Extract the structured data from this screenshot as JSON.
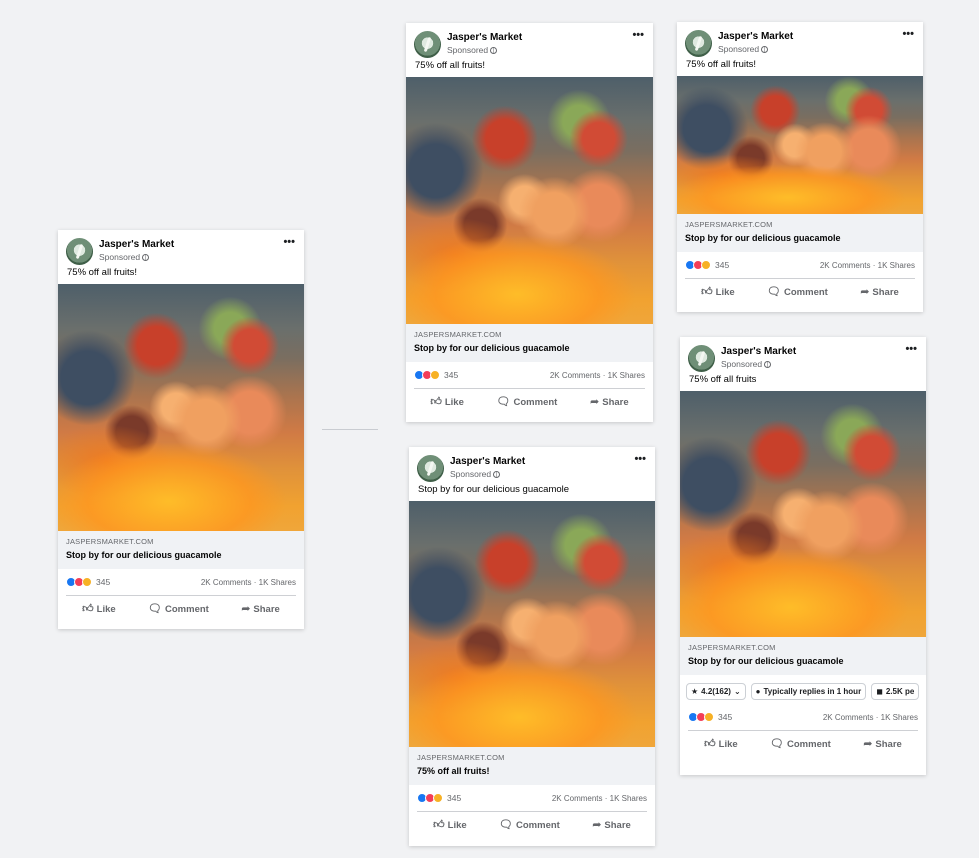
{
  "colors": {
    "background": "#f1f2f4",
    "accent": "#1877f2",
    "link_box": "#f0f2f5",
    "muted_text": "#65676b"
  },
  "icons": {
    "more": "more-dots-icon",
    "globe": "globe-icon",
    "like": "thumbs-up-icon",
    "comment": "comment-icon",
    "share": "share-icon",
    "star": "star-icon",
    "messenger": "messenger-icon"
  },
  "ads": [
    {
      "page_name": "Jasper's Market",
      "sponsored": "Sponsored",
      "primary_text": "75% off all fruits!",
      "link_url": "JASPERSMARKET.COM",
      "link_title": "Stop by for our delicious guacamole",
      "reaction_count": "345",
      "comments_shares": "2K Comments · 1K Shares",
      "like": "Like",
      "comment": "Comment",
      "share": "Share"
    },
    {
      "page_name": "Jasper's Market",
      "sponsored": "Sponsored",
      "primary_text": "75% off all fruits!",
      "link_url": "JASPERSMARKET.COM",
      "link_title": "Stop by for our delicious guacamole",
      "reaction_count": "345",
      "comments_shares": "2K Comments · 1K Shares",
      "like": "Like",
      "comment": "Comment",
      "share": "Share"
    },
    {
      "page_name": "Jasper's Market",
      "sponsored": "Sponsored",
      "primary_text": "Stop by for our delicious guacamole",
      "link_url": "JASPERSMARKET.COM",
      "link_title": "75% off all fruits!",
      "reaction_count": "345",
      "comments_shares": "2K Comments · 1K Shares",
      "like": "Like",
      "comment": "Comment",
      "share": "Share"
    },
    {
      "page_name": "Jasper's Market",
      "sponsored": "Sponsored",
      "primary_text": "75% off all fruits!",
      "link_url": "JASPERSMARKET.COM",
      "link_title": "Stop by for our delicious guacamole",
      "reaction_count": "345",
      "comments_shares": "2K Comments · 1K Shares",
      "like": "Like",
      "comment": "Comment",
      "share": "Share"
    },
    {
      "page_name": "Jasper's Market",
      "sponsored": "Sponsored",
      "primary_text": "75% off all fruits",
      "link_url": "JASPERSMARKET.COM",
      "link_title": "Stop by for our delicious guacamole",
      "pills": {
        "rating": "4.2(162)",
        "replies": "Typically replies in 1 hour",
        "followers": "2.5K pe"
      },
      "reaction_count": "345",
      "comments_shares": "2K Comments · 1K Shares",
      "like": "Like",
      "comment": "Comment",
      "share": "Share"
    }
  ]
}
